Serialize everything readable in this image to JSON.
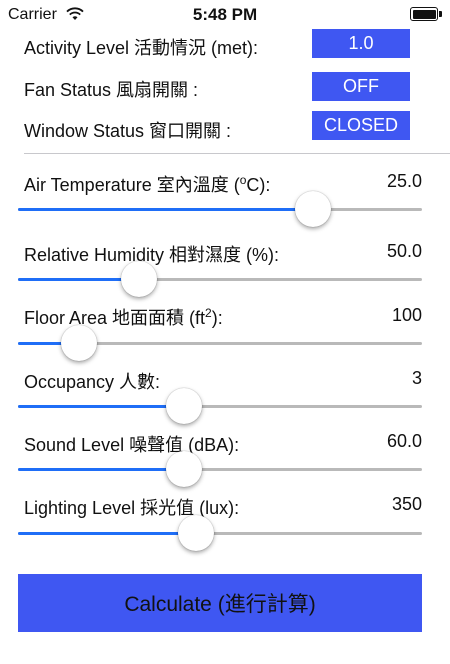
{
  "status_bar": {
    "carrier": "Carrier",
    "time": "5:48 PM"
  },
  "settings": {
    "activity": {
      "label": "Activity Level 活動情況 (met):",
      "value": "1.0"
    },
    "fan": {
      "label": "Fan Status 風扇開關 :",
      "value": "OFF"
    },
    "window": {
      "label": "Window Status 窗口開關 :",
      "value": "CLOSED"
    }
  },
  "sliders": {
    "air_temperature": {
      "label_before": "Air Temperature 室內溫度 (",
      "label_sup": "o",
      "label_after": "C):",
      "value": "25.0",
      "level": 0.73
    },
    "relative_humidity": {
      "label": "Relative Humidity 相對濕度 (%):",
      "value": "50.0",
      "level": 0.3
    },
    "floor_area": {
      "label_before": "Floor Area 地面面積 (ft",
      "label_sup": "2",
      "label_after": "):",
      "value": "100",
      "level": 0.15
    },
    "occupancy": {
      "label": "Occupancy 人數:",
      "value": "3",
      "level": 0.41
    },
    "sound_level": {
      "label": "Sound Level 噪聲值 (dBA):",
      "value": "60.0",
      "level": 0.41
    },
    "lighting_level": {
      "label": "Lighting Level 採光值 (lux):",
      "value": "350",
      "level": 0.44
    }
  },
  "calculate_label": "Calculate (進行計算)",
  "colors": {
    "accent": "#3f57f2",
    "slider_fill": "#1f6ef7",
    "slider_track": "#b9b9b9"
  },
  "icons": [
    "wifi-icon",
    "battery-icon"
  ]
}
